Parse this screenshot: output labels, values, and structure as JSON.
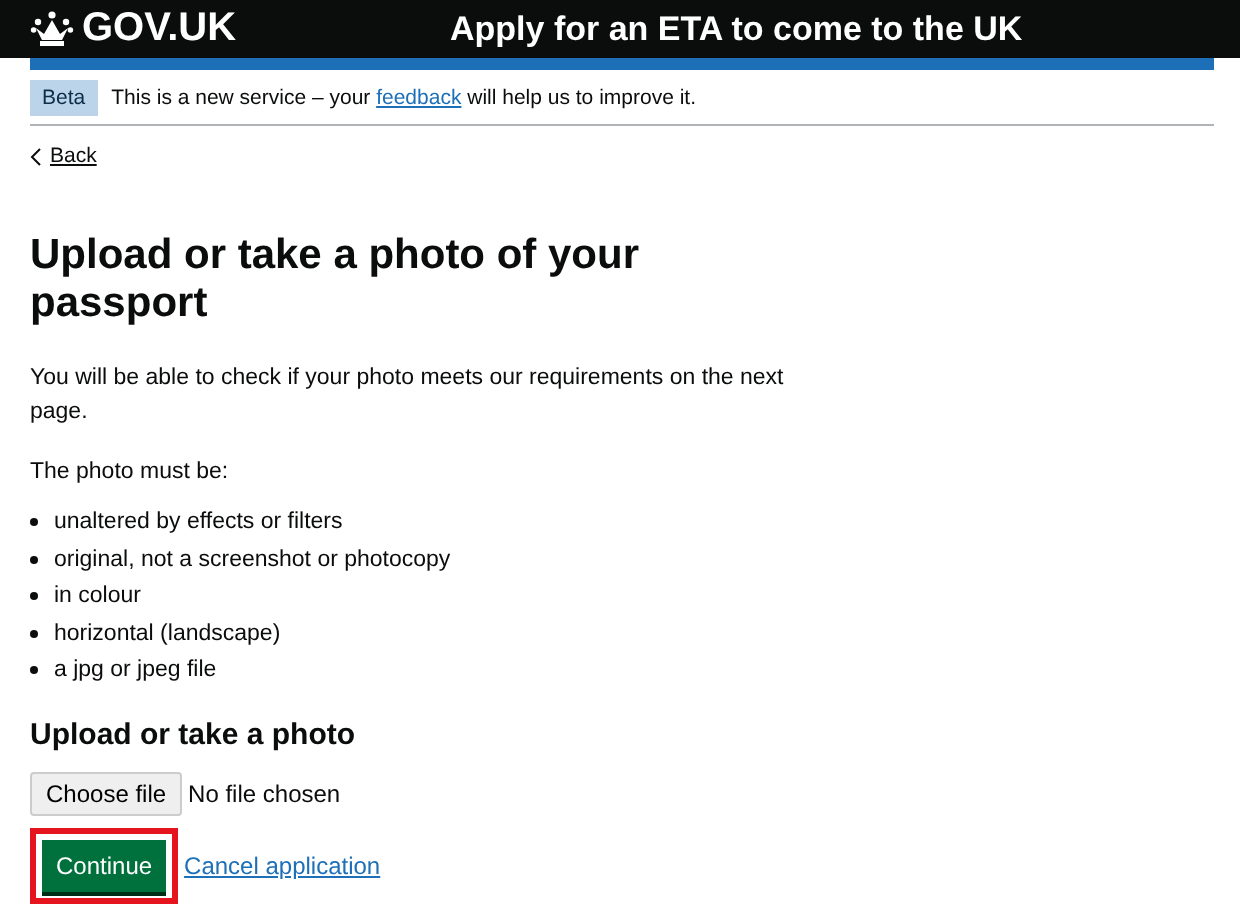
{
  "header": {
    "logo": "GOV.UK",
    "service_name": "Apply for an ETA to come to the UK"
  },
  "phase_banner": {
    "tag": "Beta",
    "text_before": "This is a new service – your",
    "link": "feedback",
    "text_after": "will help us to improve it."
  },
  "back_link": "Back",
  "heading": "Upload or take a photo of your passport",
  "intro": "You will be able to check if your photo meets our requirements on the next page.",
  "list_lead": "The photo must be:",
  "requirements": [
    "unaltered by effects or filters",
    "original, not a screenshot or photocopy",
    "in colour",
    "horizontal (landscape)",
    "a jpg or jpeg file"
  ],
  "upload": {
    "label": "Upload or take a photo",
    "button": "Choose file",
    "status": "No file chosen"
  },
  "continue_button": {
    "label": "Continue",
    "highlighted": true
  },
  "cancel_link": "Cancel application"
}
